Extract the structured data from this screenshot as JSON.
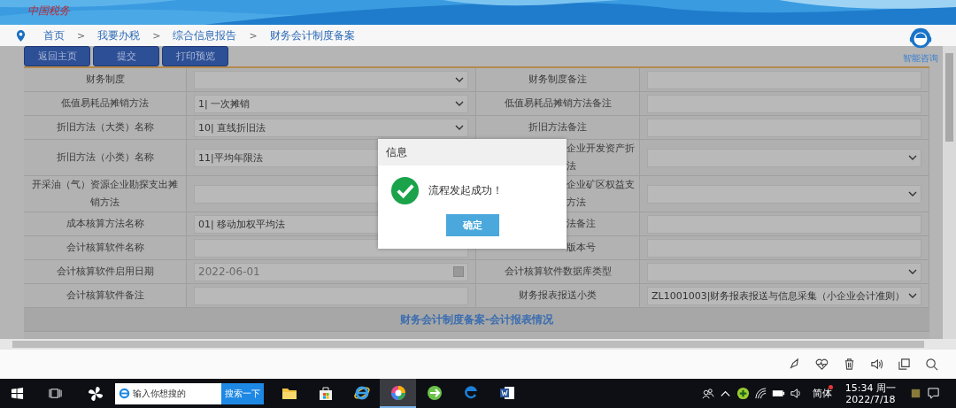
{
  "header": {
    "logo": "中国税务"
  },
  "breadcrumb": {
    "separator": ">",
    "items": [
      "首页",
      "我要办税",
      "综合信息报告",
      "财务会计制度备案"
    ]
  },
  "help": {
    "label": "智能咨询"
  },
  "toolbar": {
    "buttons": [
      "返回主页",
      "提交",
      "打印预览"
    ]
  },
  "form": {
    "rows": [
      {
        "left": {
          "label": "财务制度",
          "field": {
            "kind": "select"
          }
        },
        "right": {
          "label": "财务制度备注",
          "field": {
            "kind": "input"
          }
        },
        "tall": false
      },
      {
        "left": {
          "label": "低值易耗品摊销方法",
          "field": {
            "kind": "select",
            "value": "1| 一次摊销"
          }
        },
        "right": {
          "label": "低值易耗品摊销方法备注",
          "field": {
            "kind": "input"
          }
        },
        "tall": false
      },
      {
        "left": {
          "label": "折旧方法（大类）名称",
          "field": {
            "kind": "select",
            "value": "10| 直线折旧法"
          }
        },
        "right": {
          "label": "折旧方法备注",
          "field": {
            "kind": "input"
          }
        },
        "tall": false
      },
      {
        "left": {
          "label": "折旧方法（小类）名称",
          "field": {
            "kind": "input",
            "value": "11|平均年限法"
          }
        },
        "right": {
          "lines": [
            "企业开发资产折",
            "法"
          ],
          "field": {
            "kind": "select"
          }
        },
        "tall": true
      },
      {
        "left": {
          "label": "开采油（气）资源企业勘探支出摊销方法",
          "field": {
            "kind": "input"
          }
        },
        "right": {
          "lines": [
            "企业矿区权益支",
            "方法"
          ],
          "field": {
            "kind": "select"
          }
        },
        "tall": true
      },
      {
        "left": {
          "label": "成本核算方法名称",
          "field": {
            "kind": "input",
            "value": "01| 移动加权平均法"
          }
        },
        "right": {
          "lines": [
            "法备注"
          ],
          "field": {
            "kind": "input"
          }
        },
        "tall": false
      },
      {
        "left": {
          "label": "会计核算软件名称",
          "field": {
            "kind": "input"
          }
        },
        "right": {
          "lines": [
            "版本号"
          ],
          "field": {
            "kind": "input"
          }
        },
        "tall": false
      },
      {
        "left": {
          "label": "会计核算软件启用日期",
          "field": {
            "kind": "date",
            "value": "2022-06-01"
          }
        },
        "right": {
          "label": "会计核算软件数据库类型",
          "field": {
            "kind": "select"
          }
        },
        "tall": false
      },
      {
        "left": {
          "label": "会计核算软件备注",
          "field": {
            "kind": "input"
          }
        },
        "right": {
          "label": "财务报表报送小类",
          "field": {
            "kind": "select",
            "value": "ZL1001003|财务报表报送与信息采集（小企业会计准则）"
          }
        },
        "tall": false
      }
    ],
    "section": "财务会计制度备案-会计报表情况"
  },
  "dialog": {
    "title": "信息",
    "message": "流程发起成功！",
    "button": "确定"
  },
  "taskbar": {
    "search": {
      "placeholder": "输入你想搜的",
      "button": "搜索一下"
    },
    "apps": [
      {
        "kind": "explorer",
        "selected": false
      },
      {
        "kind": "store",
        "selected": false
      },
      {
        "kind": "ie",
        "selected": false
      },
      {
        "kind": "browser",
        "selected": true
      },
      {
        "kind": "green",
        "selected": false
      },
      {
        "kind": "edge",
        "selected": false
      },
      {
        "kind": "word",
        "selected": false
      }
    ],
    "ime": "简体",
    "time": "15:34 周一",
    "date": "2022/7/18"
  }
}
